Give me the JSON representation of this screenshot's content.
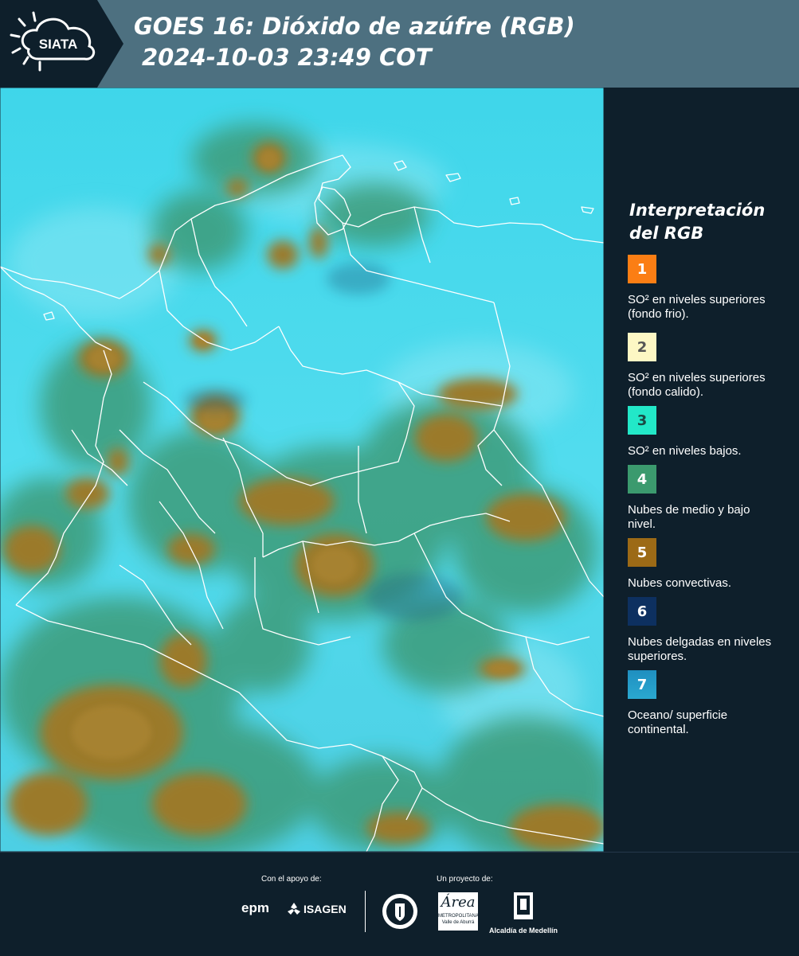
{
  "header": {
    "logo_text": "SIATA",
    "title_line1": "GOES 16: Dióxido de azúfre (RGB)",
    "title_line2": "2024-10-03 23:49 COT",
    "background_color": "#4d7080"
  },
  "legend": {
    "title": "Interpretación del RGB",
    "items": [
      {
        "number": "1",
        "color": "#fb7e14",
        "number_color": "#ffffff",
        "label": "SO² en niveles superiores (fondo frio)."
      },
      {
        "number": "2",
        "color": "#fdf7c4",
        "number_color": "#555555",
        "label": "SO² en niveles superiores (fondo calido)."
      },
      {
        "number": "3",
        "color": "#22e8c8",
        "number_color": "#1a4a44",
        "label": "SO² en niveles bajos."
      },
      {
        "number": "4",
        "color": "#3b9a6e",
        "number_color": "#ffffff",
        "label": "Nubes de medio y bajo nivel."
      },
      {
        "number": "5",
        "color": "#9c6a16",
        "number_color": "#ffffff",
        "label": "Nubes convectivas."
      },
      {
        "number": "6",
        "color": "#0d3060",
        "number_color": "#ffffff",
        "label": "Nubes delgadas en niveles superiores."
      },
      {
        "number": "7",
        "color": "#1f8fc0",
        "number_color": "#ffffff",
        "label": "Oceano/ superficie continental."
      }
    ]
  },
  "footer": {
    "support_label": "Con el apoyo de:",
    "project_label": "Un proyecto de:",
    "logo_epm": "epm",
    "logo_isagen": "ISAGEN",
    "logo_area": "Área",
    "logo_area_sub": "METROPOLITANA",
    "logo_area_sub2": "Valle de Aburrá",
    "logo_alcaldia": "Alcaldía de Medellín"
  },
  "colors": {
    "ocean_cyan": "#45d8ec",
    "land_green": "#3f9c78",
    "convective_brown": "#9b7a2c",
    "borders": "#ffffff",
    "panel_bg": "#0e1f2b"
  }
}
